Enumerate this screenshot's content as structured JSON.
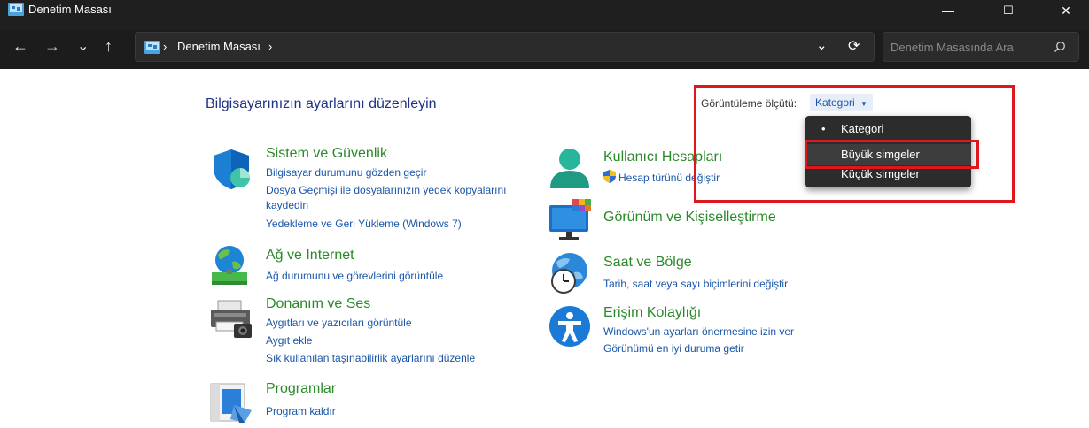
{
  "window": {
    "title": "Denetim Masası",
    "controls": {
      "minimize": "—",
      "maximize": "☐",
      "close": "✕"
    }
  },
  "navigation": {
    "back": "←",
    "forward": "→",
    "history": "⌄",
    "up": "↑",
    "breadcrumb": [
      "Denetim Masası"
    ],
    "separator": "›",
    "refresh": "⟳",
    "dropdown": "⌄",
    "search_placeholder": "Denetim Masasında Ara"
  },
  "main": {
    "heading": "Bilgisayarınızın ayarlarını düzenleyin",
    "view_by": {
      "label": "Görüntüleme ölçütü:",
      "selected": "Kategori",
      "options": [
        {
          "label": "Kategori",
          "selected": true
        },
        {
          "label": "Büyük simgeler",
          "selected": false
        },
        {
          "label": "Küçük simgeler",
          "selected": false
        }
      ]
    },
    "categories_left": [
      {
        "title": "Sistem ve Güvenlik",
        "icon": "shield-icon",
        "links": [
          "Bilgisayar durumunu gözden geçir",
          "Dosya Geçmişi ile dosyalarınızın yedek kopyalarını",
          "kaydedin",
          "Yedekleme ve Geri Yükleme (Windows 7)"
        ]
      },
      {
        "title": "Ağ ve Internet",
        "icon": "network-icon",
        "links": [
          "Ağ durumunu ve görevlerini görüntüle"
        ]
      },
      {
        "title": "Donanım ve Ses",
        "icon": "printer-icon",
        "links": [
          "Aygıtları ve yazıcıları görüntüle",
          "Aygıt ekle",
          "Sık kullanılan taşınabilirlik ayarlarını düzenle"
        ]
      },
      {
        "title": "Programlar",
        "icon": "programs-icon",
        "links": [
          "Program kaldır"
        ]
      }
    ],
    "categories_right": [
      {
        "title": "Kullanıcı Hesapları",
        "icon": "user-icon",
        "links": [
          "Hesap türünü değiştir"
        ]
      },
      {
        "title": "Görünüm ve Kişiselleştirme",
        "icon": "monitor-icon",
        "links": []
      },
      {
        "title": "Saat ve Bölge",
        "icon": "clock-globe-icon",
        "links": [
          "Tarih, saat veya sayı biçimlerini değiştir"
        ]
      },
      {
        "title": "Erişim Kolaylığı",
        "icon": "accessibility-icon",
        "links": [
          "Windows'un ayarları önermesine izin ver",
          "Görünümü en iyi duruma getir"
        ]
      }
    ]
  },
  "colors": {
    "highlight_box": "#e0161d",
    "category_title": "#2a8a2a",
    "link": "#1a56a8",
    "heading": "#1e3287"
  }
}
